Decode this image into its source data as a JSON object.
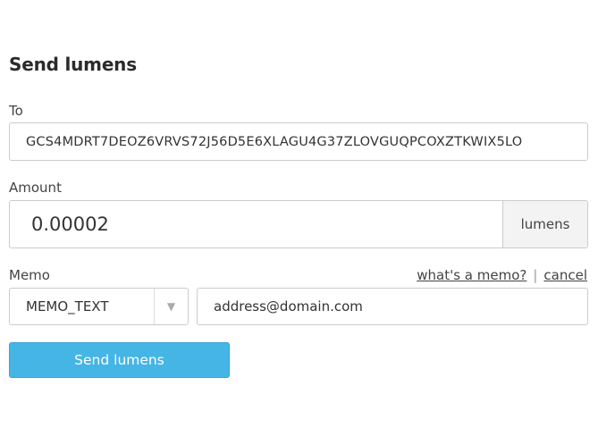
{
  "form": {
    "title": "Send lumens",
    "to": {
      "label": "To",
      "value": "GCS4MDRT7DEOZ6VRVS72J56D5E6XLAGU4G37ZLOVGUQPCOXZTKWIX5LO"
    },
    "amount": {
      "label": "Amount",
      "value": "0.00002",
      "unit": "lumens"
    },
    "memo": {
      "label": "Memo",
      "help_link": "what's a memo?",
      "separator": "|",
      "cancel_link": "cancel",
      "type_selected": "MEMO_TEXT",
      "arrow_glyph": "▼",
      "value": "address@domain.com"
    },
    "submit_label": "Send lumens"
  },
  "colors": {
    "button_bg": "#45b5e5",
    "addon_bg": "#f3f3f3",
    "border": "#cccccc"
  }
}
